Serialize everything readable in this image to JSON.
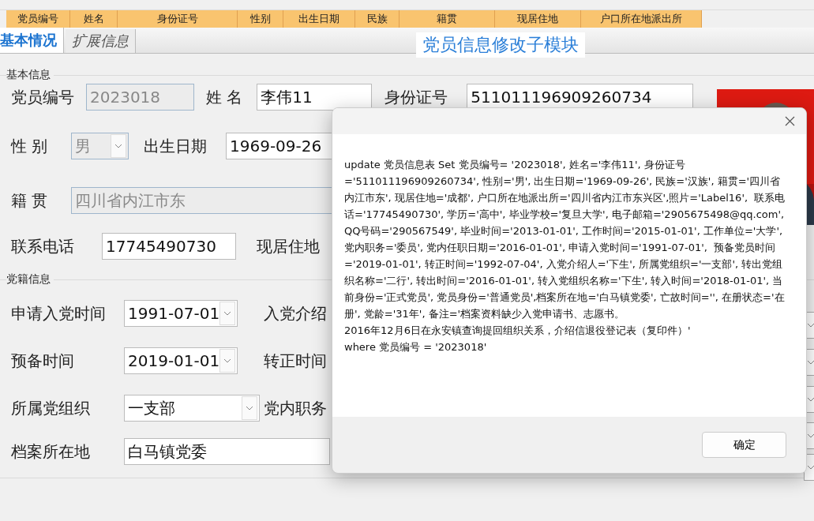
{
  "grid_header": {
    "columns": [
      "党员编号",
      "姓名",
      "身份证号",
      "性别",
      "出生日期",
      "民族",
      "籍贯",
      "现居住地",
      "户口所在地派出所"
    ]
  },
  "tabs": [
    {
      "label": "基本情况",
      "selected": true
    },
    {
      "label": "扩展信息",
      "selected": false
    }
  ],
  "module_title": "党员信息修改子模块",
  "basic_info": {
    "title": "基本信息",
    "member_no": {
      "label": "党员编号",
      "value": "2023018",
      "disabled": true
    },
    "name": {
      "label": "姓 名",
      "value": "李伟11"
    },
    "id_number": {
      "label": "身份证号",
      "value": "511011196909260734"
    },
    "gender": {
      "label": "性 别",
      "value": "男",
      "disabled": true
    },
    "birth_date": {
      "label": "出生日期",
      "value": "1969-09-26"
    },
    "native_place": {
      "label": "籍 贯",
      "value": "四川省内江市东",
      "disabled": true
    },
    "phone": {
      "label": "联系电话",
      "value": "17745490730"
    },
    "residence": {
      "label": "现居住地"
    }
  },
  "party_info": {
    "title": "党籍信息",
    "rows": [
      {
        "label": "申请入党时间",
        "value": "1991-07-01",
        "kind": "date",
        "side_label": "入党介绍"
      },
      {
        "label": "预备时间",
        "value": "2019-01-01",
        "kind": "date",
        "side_label": "转正时间"
      },
      {
        "label": "所属党组织",
        "value": "一支部",
        "kind": "combo",
        "side_label": "党内职务"
      },
      {
        "label": "档案所在地",
        "value": "白马镇党委",
        "kind": "text"
      }
    ]
  },
  "dialog": {
    "message": "update 党员信息表 Set 党员编号= '2023018', 姓名='李伟11', 身份证号='511011196909260734', 性别='男', 出生日期='1969-09-26', 民族='汉族', 籍贯='四川省内江市东', 现居住地='成都', 户口所在地派出所='四川省内江市东兴区',照片='Label16',  联系电话='17745490730', 学历='高中', 毕业学校='复旦大学', 电子邮箱='2905675498@qq.com', QQ号码='290567549', 毕业时间='2013-01-01', 工作时间='2015-01-01', 工作单位='大学', 党内职务='委员', 党内任职日期='2016-01-01', 申请入党时间='1991-07-01',  预备党员时间='2019-01-01', 转正时间='1992-07-04', 入党介绍人='下生', 所属党组织='一支部', 转出党组织名称='二行', 转出时间='2016-01-01', 转入党组织名称='下生', 转入时间='2018-01-01', 当前身份='正式党员', 党员身份='普通党员',档案所在地='白马镇党委', 亡故时间='', 在册状态='在册', 党龄='31年', 备注='档案资料缺少入党申请书、志愿书。\n2016年12月6日在永安镇查询提回组织关系，介绍信退役登记表（复印件）'\nwhere 党员编号 = '2023018'",
    "ok_button": "确定"
  }
}
